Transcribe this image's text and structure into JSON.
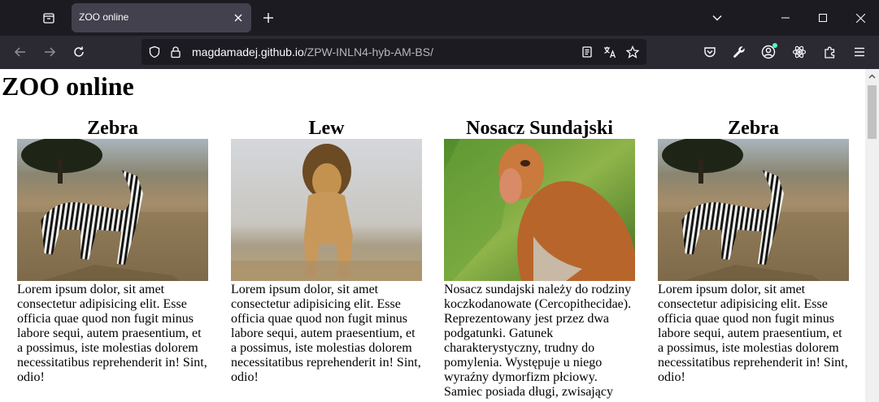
{
  "tabstrip": {
    "tab_title": "ZOO online"
  },
  "navbar": {
    "url_domain": "magdamadej.github.io",
    "url_path": "/ZPW-INLN4-hyb-AM-BS/"
  },
  "page": {
    "heading": "ZOO online",
    "cards": [
      {
        "title": "Zebra",
        "image": "zebra-photo",
        "text": "Lorem ipsum dolor, sit amet consectetur adipisicing elit. Esse officia quae quod non fugit minus labore sequi, autem praesentium, et a possimus, iste molestias dolorem necessitatibus reprehenderit in! Sint, odio!"
      },
      {
        "title": "Lew",
        "image": "lion-photo",
        "text": "Lorem ipsum dolor, sit amet consectetur adipisicing elit. Esse officia quae quod non fugit minus labore sequi, autem praesentium, et a possimus, iste molestias dolorem necessitatibus reprehenderit in! Sint, odio!"
      },
      {
        "title": "Nosacz Sundajski",
        "image": "proboscis-monkey-photo",
        "text": "Nosacz sundajski należy do rodziny koczkodanowate (Cercopithecidae). Reprezentowany jest przez dwa podgatunki. Gatunek charakterystyczny, trudny do pomylenia. Występuje u niego wyraźny dymorfizm płciowy. Samiec posiada długi, zwisający"
      },
      {
        "title": "Zebra",
        "image": "zebra-photo",
        "text": "Lorem ipsum dolor, sit amet consectetur adipisicing elit. Esse officia quae quod non fugit minus labore sequi, autem praesentium, et a possimus, iste molestias dolorem necessitatibus reprehenderit in! Sint, odio!"
      }
    ]
  },
  "colors": {
    "chrome_dark": "#1c1b22",
    "toolbar": "#2b2a33",
    "tab_active": "#42414d",
    "page_bg": "#ffffff"
  }
}
